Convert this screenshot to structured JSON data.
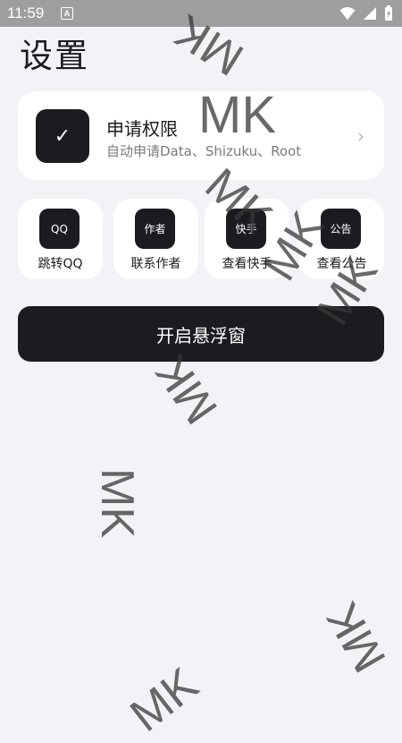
{
  "status_bar": {
    "time": "11:59",
    "notification_icon": "A"
  },
  "page": {
    "title": "设置"
  },
  "permission_card": {
    "icon": "✓",
    "title": "申请权限",
    "subtitle": "自动申请Data、Shizuku、Root",
    "chevron": "›"
  },
  "actions": [
    {
      "icon_text": "QQ",
      "label": "跳转QQ"
    },
    {
      "icon_text": "作者",
      "label": "联系作者"
    },
    {
      "icon_text": "快手",
      "label": "查看快手"
    },
    {
      "icon_text": "公告",
      "label": "查看公告"
    }
  ],
  "float_button": {
    "label": "开启悬浮窗"
  },
  "watermark": {
    "text": "MK"
  },
  "colors": {
    "background": "#f3f2f7",
    "card": "#ffffff",
    "accent_dark": "#1c1b20",
    "status_bar": "#9e9e9e"
  }
}
